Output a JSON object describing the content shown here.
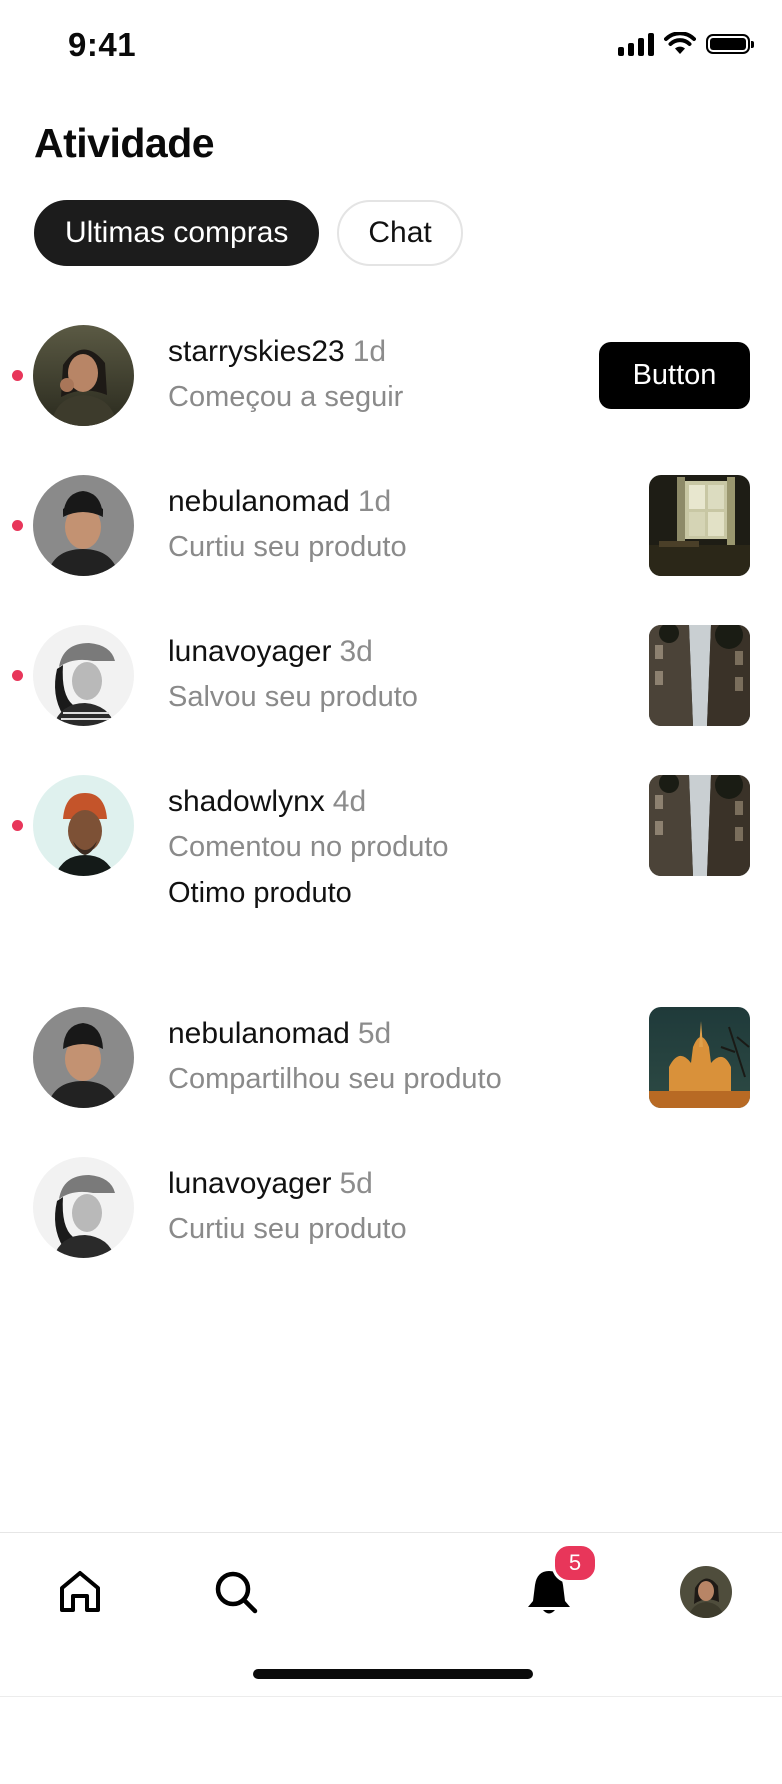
{
  "status_bar": {
    "time": "9:41"
  },
  "page": {
    "title": "Atividade"
  },
  "tabs": [
    {
      "label": "Ultimas compras",
      "active": true
    },
    {
      "label": "Chat",
      "active": false
    }
  ],
  "activities": [
    {
      "username": "starryskies23",
      "ago": "1d",
      "action": "Começou a seguir",
      "unread": true,
      "button_label": "Button"
    },
    {
      "username": "nebulanomad",
      "ago": "1d",
      "action": "Curtiu seu produto",
      "unread": true,
      "thumb": "window-room"
    },
    {
      "username": "lunavoyager",
      "ago": "3d",
      "action": "Salvou seu produto",
      "unread": true,
      "thumb": "city-street"
    },
    {
      "username": "shadowlynx",
      "ago": "4d",
      "action": "Comentou no produto",
      "comment": "Otimo produto",
      "unread": true,
      "thumb": "city-street"
    },
    {
      "username": "nebulanomad",
      "ago": "5d",
      "action": "Compartilhou seu produto",
      "unread": false,
      "thumb": "basilica-night"
    },
    {
      "username": "lunavoyager",
      "ago": "5d",
      "action": "Curtiu seu produto",
      "unread": false
    }
  ],
  "tab_bar": {
    "notification_count": "5"
  },
  "colors": {
    "accent": "#e8365a",
    "primary": "#000000",
    "muted_text": "#8a8a8a"
  }
}
